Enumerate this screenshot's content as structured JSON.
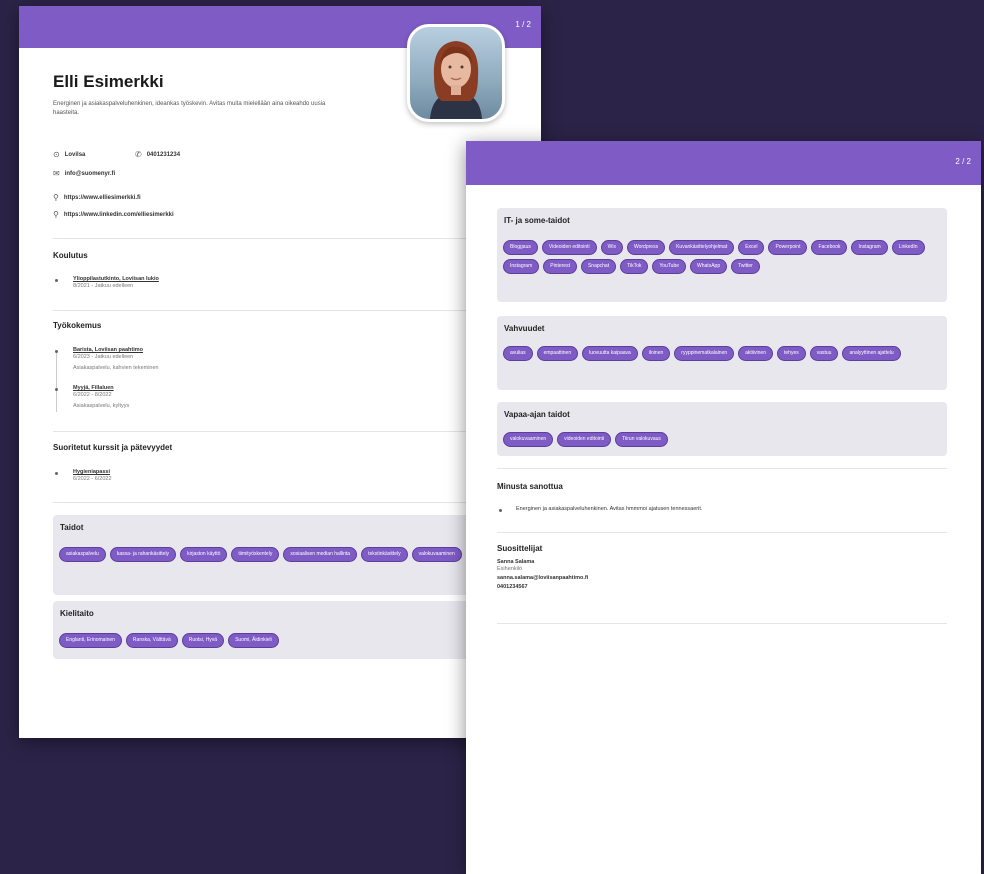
{
  "page1": {
    "page_number": "1 / 2",
    "name": "Elli Esimerkki",
    "summary": "Energinen ja asiakaspalveluhenkinen, ideankas työskevin. Avitas muita mielellään aina oikeahdo uusia haasteita.",
    "contacts": {
      "location": "Lovilsa",
      "phone": "0401231234",
      "email": "info@suomenyr.fi",
      "website": "https://www.elliesimerkki.fi",
      "linkedin": "https://www.linkedin.com/elliesimerkki"
    },
    "education": {
      "title": "Koulutus",
      "items": [
        {
          "name": "Ylioppilastutkinto, Loviisan lukio",
          "dates": "8/2021 - Jatkuu edelleen"
        }
      ]
    },
    "experience": {
      "title": "Työkokemus",
      "items": [
        {
          "name": "Barista, Loviisan paahtimo",
          "dates": "6/2023 - Jatkuu edelleen",
          "desc": "Asiakaspalvelu, kahvien tekeminen"
        },
        {
          "name": "Myyjä, Fillaluen",
          "dates": "6/2022 - 8/2022",
          "desc": "Asiakaspalvelu, kyltyys"
        }
      ]
    },
    "courses": {
      "title": "Suoritetut kurssit ja pätevyydet",
      "items": [
        {
          "name": "Hygieniapassi",
          "dates": "6/2022 - 6/2022"
        }
      ]
    },
    "skills": {
      "title": "Taidot",
      "chips": [
        "asiakaspalvelu",
        "kassa- ja rahankäsittely",
        "kirjaston käyttö",
        "tiimityöskentely",
        "sosiaalisen median hallinta",
        "tekstinkäsittely",
        "valokuvaaminen"
      ]
    },
    "languages": {
      "title": "Kielitaito",
      "chips": [
        "Englanti, Erinomainen",
        "Ranska, Välttävä",
        "Ruotsi, Hyvä",
        "Suomi, Äidinkieli"
      ]
    }
  },
  "page2": {
    "page_number": "2 / 2",
    "it_skills": {
      "title": "IT- ja some-taidot",
      "chips": [
        "Bloggaus",
        "Videoiden editointi",
        "Wix",
        "Wordpress",
        "Kuvankäsittelyohjelmat",
        "Excel",
        "Powerpoint",
        "Facebook",
        "Instagram",
        "LinkedIn",
        "Instagram",
        "Pinterest",
        "Snapchat",
        "TikTok",
        "YouTube",
        "WhatsApp",
        "Twitter"
      ]
    },
    "strengths": {
      "title": "Vahvuudet",
      "chips": [
        "avulias",
        "empaattinen",
        "luovuutta kaipaava",
        "iloinen",
        "ryyppinematkalainen",
        "aktiivinen",
        "tehyes",
        "vastuu",
        "analyyttinen ajattelu"
      ]
    },
    "hobbies": {
      "title": "Vapaa-ajan taidot",
      "chips": [
        "valokuvaaminen",
        "videoiden editointi",
        "Tiirun valokuvaus"
      ]
    },
    "about": {
      "title": "Minusta sanottua",
      "items": [
        "Energinen ja asiakaspalveluhenkinen. Avitas hmmmoi ajatusen tennessaerit."
      ]
    },
    "references": {
      "title": "Suosittelijat",
      "name": "Sanna Salama",
      "role": "Esihenkilö",
      "email": "sanna.salama@loviisanpaahtimo.fi",
      "phone": "0401234567"
    }
  },
  "colors": {
    "accent": "#7f5bc6",
    "background": "#2c2448",
    "box": "#e9e7ee"
  }
}
